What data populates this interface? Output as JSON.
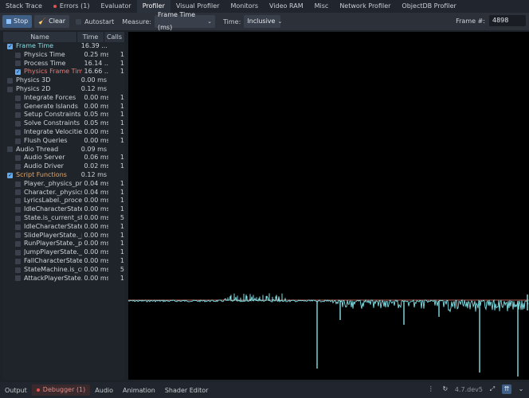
{
  "tabs": [
    {
      "label": "Stack Trace",
      "dot": false,
      "active": false
    },
    {
      "label": "Errors (1)",
      "dot": true,
      "active": false
    },
    {
      "label": "Evaluator",
      "dot": false,
      "active": false
    },
    {
      "label": "Profiler",
      "dot": false,
      "active": true
    },
    {
      "label": "Visual Profiler",
      "dot": false,
      "active": false
    },
    {
      "label": "Monitors",
      "dot": false,
      "active": false
    },
    {
      "label": "Video RAM",
      "dot": false,
      "active": false
    },
    {
      "label": "Misc",
      "dot": false,
      "active": false
    },
    {
      "label": "Network Profiler",
      "dot": false,
      "active": false
    },
    {
      "label": "ObjectDB Profiler",
      "dot": false,
      "active": false
    }
  ],
  "toolbar": {
    "stop_label": "Stop",
    "clear_label": "Clear",
    "autostart_label": "Autostart",
    "measure_label": "Measure:",
    "measure_value": "Frame Time (ms)",
    "time_label": "Time:",
    "time_value": "Inclusive",
    "frame_label": "Frame #:",
    "frame_value": "4898"
  },
  "table": {
    "headers": {
      "name": "Name",
      "time": "Time",
      "calls": "Calls"
    },
    "rows": [
      {
        "name": "Frame Time",
        "time": "16.39 ...",
        "calls": "",
        "checked": true,
        "indent": 0,
        "color": "#7fe0e6"
      },
      {
        "name": "Physics Time",
        "time": "0.25 ms",
        "calls": "1",
        "checked": false,
        "indent": 1,
        "color": "#cfd3da"
      },
      {
        "name": "Process Time",
        "time": "16.14 ...",
        "calls": "1",
        "checked": false,
        "indent": 1,
        "color": "#cfd3da"
      },
      {
        "name": "Physics Frame Time",
        "time": "16.66 ...",
        "calls": "1",
        "checked": true,
        "indent": 1,
        "color": "#e77c72"
      },
      {
        "name": "Physics 3D",
        "time": "0.00 ms",
        "calls": "",
        "checked": false,
        "indent": 0,
        "color": "#cfd3da"
      },
      {
        "name": "Physics 2D",
        "time": "0.12 ms",
        "calls": "",
        "checked": false,
        "indent": 0,
        "color": "#cfd3da"
      },
      {
        "name": "Integrate Forces",
        "time": "0.00 ms",
        "calls": "1",
        "checked": false,
        "indent": 1,
        "color": "#cfd3da"
      },
      {
        "name": "Generate Islands",
        "time": "0.00 ms",
        "calls": "1",
        "checked": false,
        "indent": 1,
        "color": "#cfd3da"
      },
      {
        "name": "Setup Constraints",
        "time": "0.05 ms",
        "calls": "1",
        "checked": false,
        "indent": 1,
        "color": "#cfd3da"
      },
      {
        "name": "Solve Constraints",
        "time": "0.05 ms",
        "calls": "1",
        "checked": false,
        "indent": 1,
        "color": "#cfd3da"
      },
      {
        "name": "Integrate Velocities",
        "time": "0.00 ms",
        "calls": "1",
        "checked": false,
        "indent": 1,
        "color": "#cfd3da"
      },
      {
        "name": "Flush Queries",
        "time": "0.00 ms",
        "calls": "1",
        "checked": false,
        "indent": 1,
        "color": "#cfd3da"
      },
      {
        "name": "Audio Thread",
        "time": "0.09 ms",
        "calls": "",
        "checked": false,
        "indent": 0,
        "color": "#cfd3da"
      },
      {
        "name": "Audio Server",
        "time": "0.06 ms",
        "calls": "1",
        "checked": false,
        "indent": 1,
        "color": "#cfd3da"
      },
      {
        "name": "Audio Driver",
        "time": "0.02 ms",
        "calls": "1",
        "checked": false,
        "indent": 1,
        "color": "#cfd3da"
      },
      {
        "name": "Script Functions",
        "time": "0.12 ms",
        "calls": "",
        "checked": true,
        "indent": 0,
        "color": "#e3a86a"
      },
      {
        "name": "Player._physics_proc...",
        "time": "0.04 ms",
        "calls": "1",
        "checked": false,
        "indent": 1,
        "color": "#cfd3da"
      },
      {
        "name": "Character._physics_p...",
        "time": "0.04 ms",
        "calls": "1",
        "checked": false,
        "indent": 1,
        "color": "#cfd3da"
      },
      {
        "name": "LyricsLabel._process",
        "time": "0.00 ms",
        "calls": "1",
        "checked": false,
        "indent": 1,
        "color": "#cfd3da"
      },
      {
        "name": "IdleCharacterState._...",
        "time": "0.00 ms",
        "calls": "1",
        "checked": false,
        "indent": 1,
        "color": "#cfd3da"
      },
      {
        "name": "State.is_current_state",
        "time": "0.00 ms",
        "calls": "5",
        "checked": false,
        "indent": 1,
        "color": "#cfd3da"
      },
      {
        "name": "IdleCharacterState._...",
        "time": "0.00 ms",
        "calls": "1",
        "checked": false,
        "indent": 1,
        "color": "#cfd3da"
      },
      {
        "name": "SlidePlayerState._pro...",
        "time": "0.00 ms",
        "calls": "1",
        "checked": false,
        "indent": 1,
        "color": "#cfd3da"
      },
      {
        "name": "RunPlayerState._proc...",
        "time": "0.00 ms",
        "calls": "1",
        "checked": false,
        "indent": 1,
        "color": "#cfd3da"
      },
      {
        "name": "JumpPlayerState._pr...",
        "time": "0.00 ms",
        "calls": "1",
        "checked": false,
        "indent": 1,
        "color": "#cfd3da"
      },
      {
        "name": "FallCharacterState._p...",
        "time": "0.00 ms",
        "calls": "1",
        "checked": false,
        "indent": 1,
        "color": "#cfd3da"
      },
      {
        "name": "StateMachine.is_curr...",
        "time": "0.00 ms",
        "calls": "5",
        "checked": false,
        "indent": 1,
        "color": "#cfd3da"
      },
      {
        "name": "AttackPlayerState._pr...",
        "time": "0.00 ms",
        "calls": "1",
        "checked": false,
        "indent": 1,
        "color": "#cfd3da"
      }
    ]
  },
  "graph": {
    "line_color": "#7fe0e6",
    "secondary_color": "#e77c72"
  },
  "bottom_tabs": [
    {
      "label": "Output",
      "active": false,
      "dot": false
    },
    {
      "label": "Debugger (1)",
      "active": true,
      "dot": true
    },
    {
      "label": "Audio",
      "active": false,
      "dot": false
    },
    {
      "label": "Animation",
      "active": false,
      "dot": false
    },
    {
      "label": "Shader Editor",
      "active": false,
      "dot": false
    }
  ],
  "status": {
    "version": "4.7.dev5",
    "icons": [
      "more-icon",
      "history-icon",
      "expand-icon",
      "pin-panel-icon",
      "collapse-icon"
    ]
  }
}
